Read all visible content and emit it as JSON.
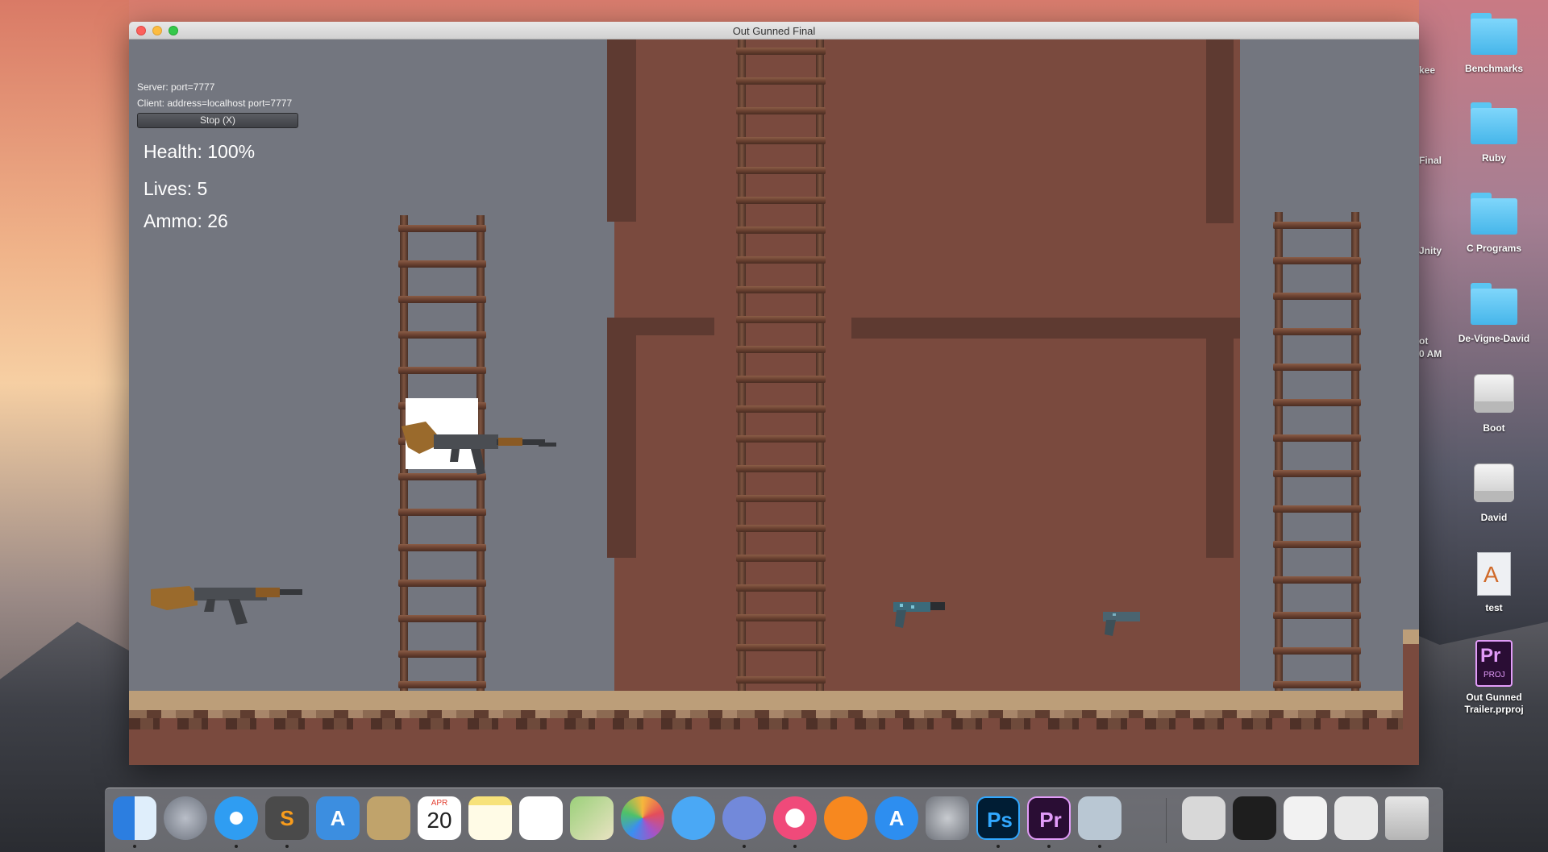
{
  "window": {
    "title": "Out Gunned Final"
  },
  "hud": {
    "server": "Server: port=7777",
    "client": "Client: address=localhost port=7777",
    "stop_button": "Stop (X)",
    "health": "Health: 100%",
    "lives": "Lives: 5",
    "ammo": "Ammo: 26"
  },
  "desktop": {
    "items": [
      {
        "label": "Benchmarks",
        "type": "folder-icon"
      },
      {
        "label": "Ruby",
        "type": "folder-icon"
      },
      {
        "label": "C Programs",
        "type": "folder-icon"
      },
      {
        "label": "De-Vigne-David",
        "type": "folder-icon"
      },
      {
        "label": "Boot",
        "type": "drive-icon"
      },
      {
        "label": "David",
        "type": "drive-icon"
      },
      {
        "label": "test",
        "type": "document-icon"
      },
      {
        "label": "Out Gunned Trailer.prproj",
        "type": "premiere-project-icon"
      }
    ],
    "partial_labels": [
      "kee",
      "Final",
      "Jnity",
      "ot",
      "0 AM"
    ],
    "premiere_icon_text": {
      "big": "Pr",
      "small": "PROJ"
    }
  },
  "dock": {
    "calendar": {
      "month": "APR",
      "day": "20"
    },
    "photoshop": "Ps",
    "premiere": "Pr",
    "items": [
      {
        "name": "finder",
        "color": "#3d8fe6"
      },
      {
        "name": "launchpad",
        "color": "#8a8f99"
      },
      {
        "name": "safari",
        "color": "#2f9df2"
      },
      {
        "name": "sublime-text",
        "color": "#4a4a4a"
      },
      {
        "name": "xcode",
        "color": "#3c8ee0"
      },
      {
        "name": "mail-stamp",
        "color": "#c0a36b"
      },
      {
        "name": "calendar",
        "color": "#ffffff"
      },
      {
        "name": "notes",
        "color": "#f7e27a"
      },
      {
        "name": "reminders",
        "color": "#ffffff"
      },
      {
        "name": "maps",
        "color": "#9bd07a"
      },
      {
        "name": "photos",
        "color": "#ffffff"
      },
      {
        "name": "messages",
        "color": "#4aa8f5"
      },
      {
        "name": "discord",
        "color": "#7289da"
      },
      {
        "name": "itunes",
        "color": "#f04a7a"
      },
      {
        "name": "ibooks",
        "color": "#f7881f"
      },
      {
        "name": "app-store",
        "color": "#2d8ef0"
      },
      {
        "name": "system-preferences",
        "color": "#8e9299"
      },
      {
        "name": "photoshop",
        "color": "#001d34"
      },
      {
        "name": "premiere",
        "color": "#2a0d34"
      },
      {
        "name": "preview",
        "color": "#b9c7d3"
      }
    ]
  },
  "colors": {
    "sky": "#73767f",
    "building": "#7a4a3e",
    "building_dark": "#5e3a31",
    "ground_top": "#bc9e79"
  }
}
